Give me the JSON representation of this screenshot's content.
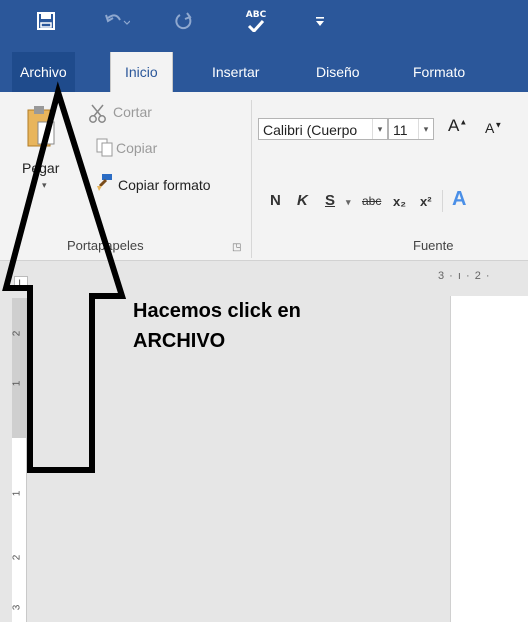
{
  "quick_access": {
    "save_icon": "save-icon",
    "undo_icon": "undo-icon",
    "redo_icon": "redo-icon",
    "spelling_icon": "spelling-abc-icon",
    "spelling_text": "ABC",
    "customize_icon": "customize-qat-icon"
  },
  "tabs": [
    {
      "label": "Archivo"
    },
    {
      "label": "Inicio"
    },
    {
      "label": "Insertar"
    },
    {
      "label": "Diseño"
    },
    {
      "label": "Formato"
    }
  ],
  "ribbon": {
    "clipboard": {
      "paste_label": "Pegar",
      "cut_label": "Cortar",
      "copy_label": "Copiar",
      "format_painter_label": "Copiar formato",
      "group_label": "Portapapeles"
    },
    "font": {
      "font_name": "Calibri (Cuerpo",
      "font_size": "11",
      "grow_font": "A",
      "shrink_font": "A",
      "bold": "N",
      "italic": "K",
      "underline": "S",
      "strikethrough": "abc",
      "subscript": "x₂",
      "superscript": "x²",
      "text_effects": "A",
      "group_label": "Fuente"
    }
  },
  "ruler": {
    "top_numbers": "3 · ı · 2 ·",
    "left_numbers": [
      "2",
      "1",
      "1",
      "2",
      "3"
    ]
  },
  "annotation": {
    "line1": "Hacemos click en",
    "line2": "ARCHIVO"
  },
  "colors": {
    "title_bar": "#2b579a",
    "ribbon": "#f3f3f3",
    "workspace": "#e6e6e6"
  }
}
